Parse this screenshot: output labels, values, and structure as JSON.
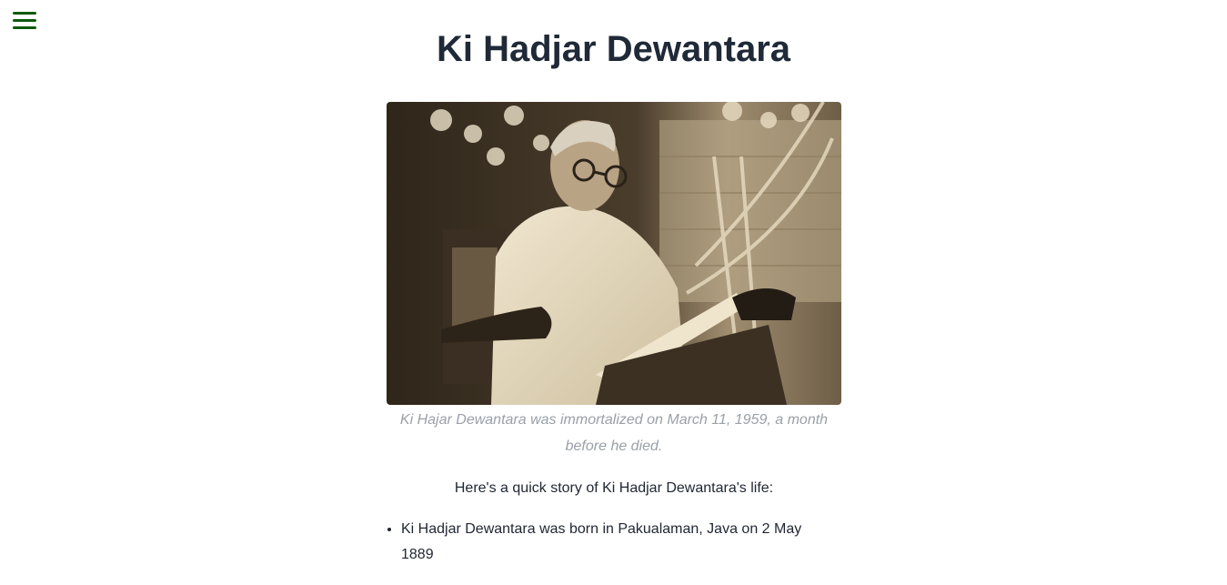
{
  "header": {
    "menu_icon": "hamburger-menu-icon",
    "title": "Ki Hadjar Dewantara"
  },
  "figure": {
    "caption": "Ki Hajar Dewantara was immortalized on March 11, 1959, a month before he died."
  },
  "article": {
    "intro": "Here's a quick story of Ki Hadjar Dewantara's life:",
    "facts": [
      "Ki Hadjar Dewantara was born in Pakualaman, Java on 2 May 1889"
    ]
  },
  "colors": {
    "menu_icon": "#0b5a0b",
    "title": "#1f2937",
    "caption": "#9aa0a8"
  }
}
